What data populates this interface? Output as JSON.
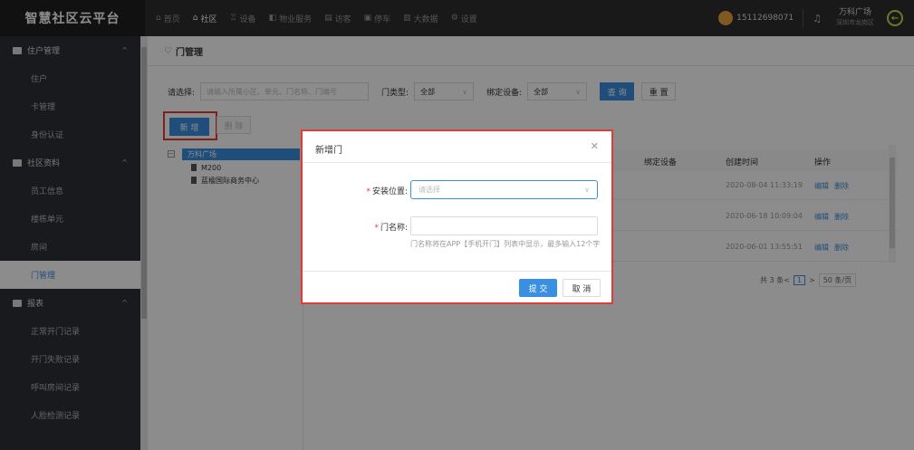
{
  "header": {
    "brand": "智慧社区云平台",
    "nav": [
      {
        "icon": "home-icon",
        "glyph": "⌂",
        "label": "首页",
        "active": false
      },
      {
        "icon": "community-icon",
        "glyph": "⌂",
        "label": "社区",
        "active": true
      },
      {
        "icon": "device-icon",
        "glyph": "♖",
        "label": "设备",
        "active": false
      },
      {
        "icon": "property-icon",
        "glyph": "◧",
        "label": "物业服务",
        "active": false
      },
      {
        "icon": "visitor-icon",
        "glyph": "▤",
        "label": "访客",
        "active": false
      },
      {
        "icon": "parking-icon",
        "glyph": "▣",
        "label": "停车",
        "active": false
      },
      {
        "icon": "bigdata-icon",
        "glyph": "▥",
        "label": "大数据",
        "active": false
      },
      {
        "icon": "settings-icon",
        "glyph": "⚙",
        "label": "设置",
        "active": false
      }
    ],
    "phone": "15112698071",
    "site_name": "万科广场",
    "site_location": "深圳市龙岗区"
  },
  "sidebar": {
    "groups": [
      {
        "icon": "resident-group-icon",
        "label": "住户管理",
        "items": [
          "住户",
          "卡管理",
          "身份认证"
        ]
      },
      {
        "icon": "community-data-group-icon",
        "label": "社区资料",
        "items": [
          "员工信息",
          "楼栋单元",
          "房间",
          "门管理"
        ]
      },
      {
        "icon": "report-group-icon",
        "label": "报表",
        "items": [
          "正常开门记录",
          "开门失败记录",
          "呼叫房间记录",
          "人脸检测记录"
        ]
      }
    ],
    "active_item": "门管理"
  },
  "breadcrumb": "门管理",
  "filter": {
    "select_label": "请选择:",
    "search_placeholder": "请输入所属小区、单元、门名称、门编号",
    "door_type_label": "门类型:",
    "door_type_value": "全部",
    "bind_device_label": "绑定设备:",
    "bind_device_value": "全部",
    "query_label": "查 询",
    "reset_label": "重 置"
  },
  "toolbar": {
    "add_label": "新 增",
    "delete_label": "删 除"
  },
  "tree": {
    "root": "万科广场",
    "children": [
      "M200",
      "蓝楹国际商务中心"
    ]
  },
  "table": {
    "headers": [
      "绑定设备",
      "创建时间",
      "操作"
    ],
    "rows": [
      {
        "created": "2020-08-04 11:33:19",
        "edit": "编辑",
        "delete": "删除"
      },
      {
        "created": "2020-06-18 10:09:04",
        "edit": "编辑",
        "delete": "删除"
      },
      {
        "created": "2020-06-01 13:55:51",
        "edit": "编辑",
        "delete": "删除"
      }
    ]
  },
  "pager": {
    "total": "共 3 条",
    "page": "1",
    "page_size": "50 条/页"
  },
  "modal": {
    "title": "新增门",
    "location_label": "安装位置:",
    "location_placeholder": "请选择",
    "name_label": "门名称:",
    "name_value": "",
    "name_hint": "门名称将在APP【手机开门】列表中显示，最多输入12个字",
    "submit_label": "提 交",
    "cancel_label": "取 消"
  },
  "colors": {
    "accent": "#3b8fe0",
    "highlight": "#e53935",
    "header_bg": "#2f2f2f",
    "sidebar_bg": "#2f3136"
  }
}
